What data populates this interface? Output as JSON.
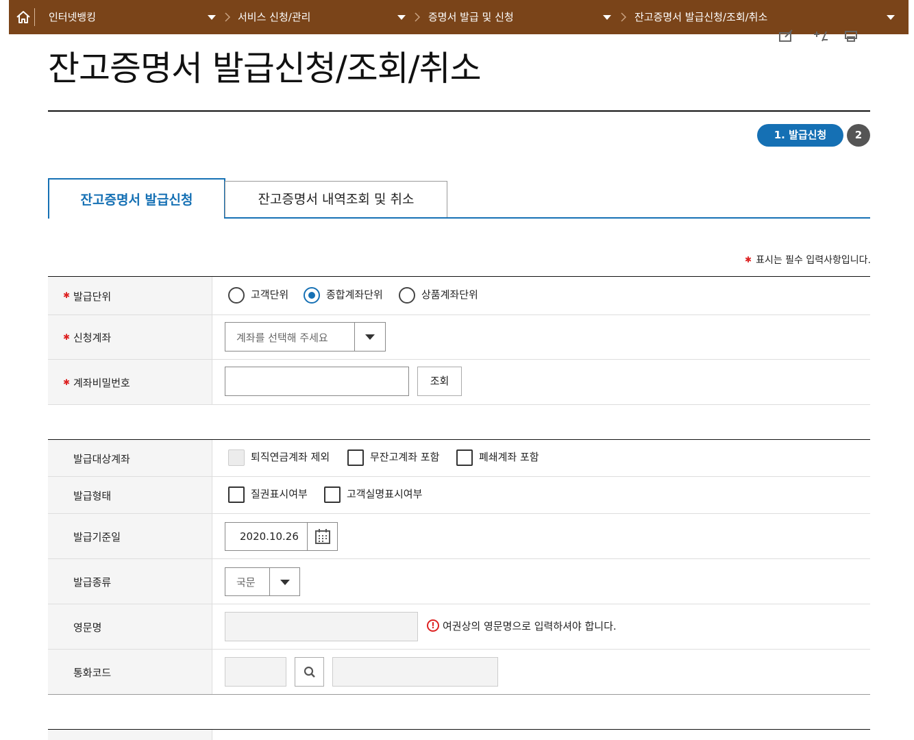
{
  "nav": {
    "home_icon": "home-icon",
    "crumbs": [
      "인터넷뱅킹",
      "서비스 신청/관리",
      "증명서 발급 및 신청",
      "잔고증명서 발급신청/조회/취소"
    ],
    "bg_color": "#7a4419"
  },
  "tools": [
    "edit-icon",
    "plus-minus-icon",
    "print-icon"
  ],
  "page_title": "잔고증명서 발급신청/조회/취소",
  "steps": {
    "step1": "1. 발급신청",
    "step2": "2"
  },
  "tabs": {
    "active": "잔고증명서 발급신청",
    "inactive": "잔고증명서 내역조회 및 취소"
  },
  "required_note": "표시는 필수 입력사항입니다.",
  "form1": {
    "unit_label": "발급단위",
    "unit_options": [
      "고객단위",
      "종합계좌단위",
      "상품계좌단위"
    ],
    "unit_selected": "종합계좌단위",
    "account_label": "신청계좌",
    "account_placeholder": "계좌를 선택해 주세요",
    "password_label": "계좌비밀번호",
    "password_value": "",
    "lookup_button": "조회"
  },
  "form2": {
    "target_label": "발급대상계좌",
    "target_options": [
      "퇴직연금계좌 제외",
      "무잔고계좌 포함",
      "폐쇄계좌 포함"
    ],
    "form_label": "발급형태",
    "form_options": [
      "질권표시여부",
      "고객실명표시여부"
    ],
    "date_label": "발급기준일",
    "date_value": "2020.10.26",
    "kind_label": "발급종류",
    "kind_value": "국문",
    "eng_name_label": "영문명",
    "eng_name_value": "",
    "eng_name_notice": "여권상의 영문명으로 입력하셔야 합니다.",
    "currency_label": "통화코드",
    "currency_code_value": "",
    "currency_name_value": ""
  },
  "colors": {
    "accent": "#1570b4",
    "required": "#dd2222"
  }
}
